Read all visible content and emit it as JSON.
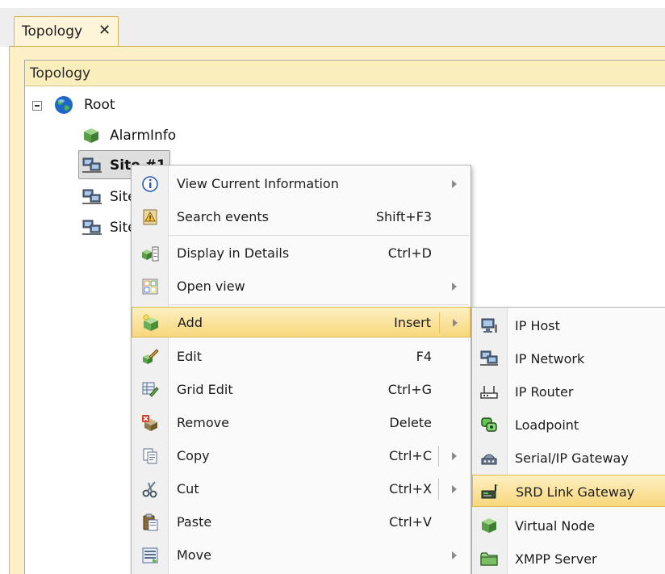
{
  "tab": {
    "label": "Topology",
    "close_glyph": "✕"
  },
  "panel": {
    "title": "Topology"
  },
  "tree": {
    "root": {
      "label": "Root",
      "icon": "globe-icon"
    },
    "children": [
      {
        "label": "AlarmInfo",
        "icon": "green-cube-icon"
      },
      {
        "label": "Site #1",
        "icon": "network-computer-icon"
      },
      {
        "label": "Site",
        "icon": "network-computer-icon"
      },
      {
        "label": "Site",
        "icon": "network-computer-icon"
      }
    ]
  },
  "context_menu": {
    "items": [
      {
        "label": "View Current Information",
        "shortcut": "",
        "submenu": true,
        "icon": "info-icon"
      },
      {
        "label": "Search events",
        "shortcut": "Shift+F3",
        "submenu": false,
        "icon": "search-events-icon"
      },
      {
        "label": "Display in Details",
        "shortcut": "Ctrl+D",
        "submenu": false,
        "icon": "details-icon"
      },
      {
        "label": "Open view",
        "shortcut": "",
        "submenu": true,
        "icon": "grid-view-icon"
      },
      {
        "label": "Add",
        "shortcut": "Insert",
        "submenu": true,
        "icon": "add-cube-icon"
      },
      {
        "label": "Edit",
        "shortcut": "F4",
        "submenu": false,
        "icon": "edit-icon"
      },
      {
        "label": "Grid Edit",
        "shortcut": "Ctrl+G",
        "submenu": false,
        "icon": "grid-edit-icon"
      },
      {
        "label": "Remove",
        "shortcut": "Delete",
        "submenu": false,
        "icon": "remove-icon"
      },
      {
        "label": "Copy",
        "shortcut": "Ctrl+C",
        "submenu": true,
        "icon": "copy-icon"
      },
      {
        "label": "Cut",
        "shortcut": "Ctrl+X",
        "submenu": true,
        "icon": "cut-icon"
      },
      {
        "label": "Paste",
        "shortcut": "Ctrl+V",
        "submenu": false,
        "icon": "paste-icon"
      },
      {
        "label": "Move",
        "shortcut": "",
        "submenu": true,
        "icon": "move-icon"
      }
    ]
  },
  "add_submenu": {
    "items": [
      {
        "label": "IP Host",
        "icon": "ip-host-icon"
      },
      {
        "label": "IP Network",
        "icon": "ip-network-icon"
      },
      {
        "label": "IP Router",
        "icon": "ip-router-icon"
      },
      {
        "label": "Loadpoint",
        "icon": "loadpoint-icon"
      },
      {
        "label": "Serial/IP Gateway",
        "icon": "serial-gateway-icon"
      },
      {
        "label": "SRD Link Gateway",
        "icon": "srd-link-gateway-icon"
      },
      {
        "label": "Virtual Node",
        "icon": "virtual-node-icon"
      },
      {
        "label": "XMPP Server",
        "icon": "folder-icon"
      }
    ]
  },
  "colors": {
    "highlight_top": "#fdf0c2",
    "highlight_bottom": "#f8d77c",
    "highlight_border": "#e0b84a",
    "panel_header": "#fbeebd"
  }
}
